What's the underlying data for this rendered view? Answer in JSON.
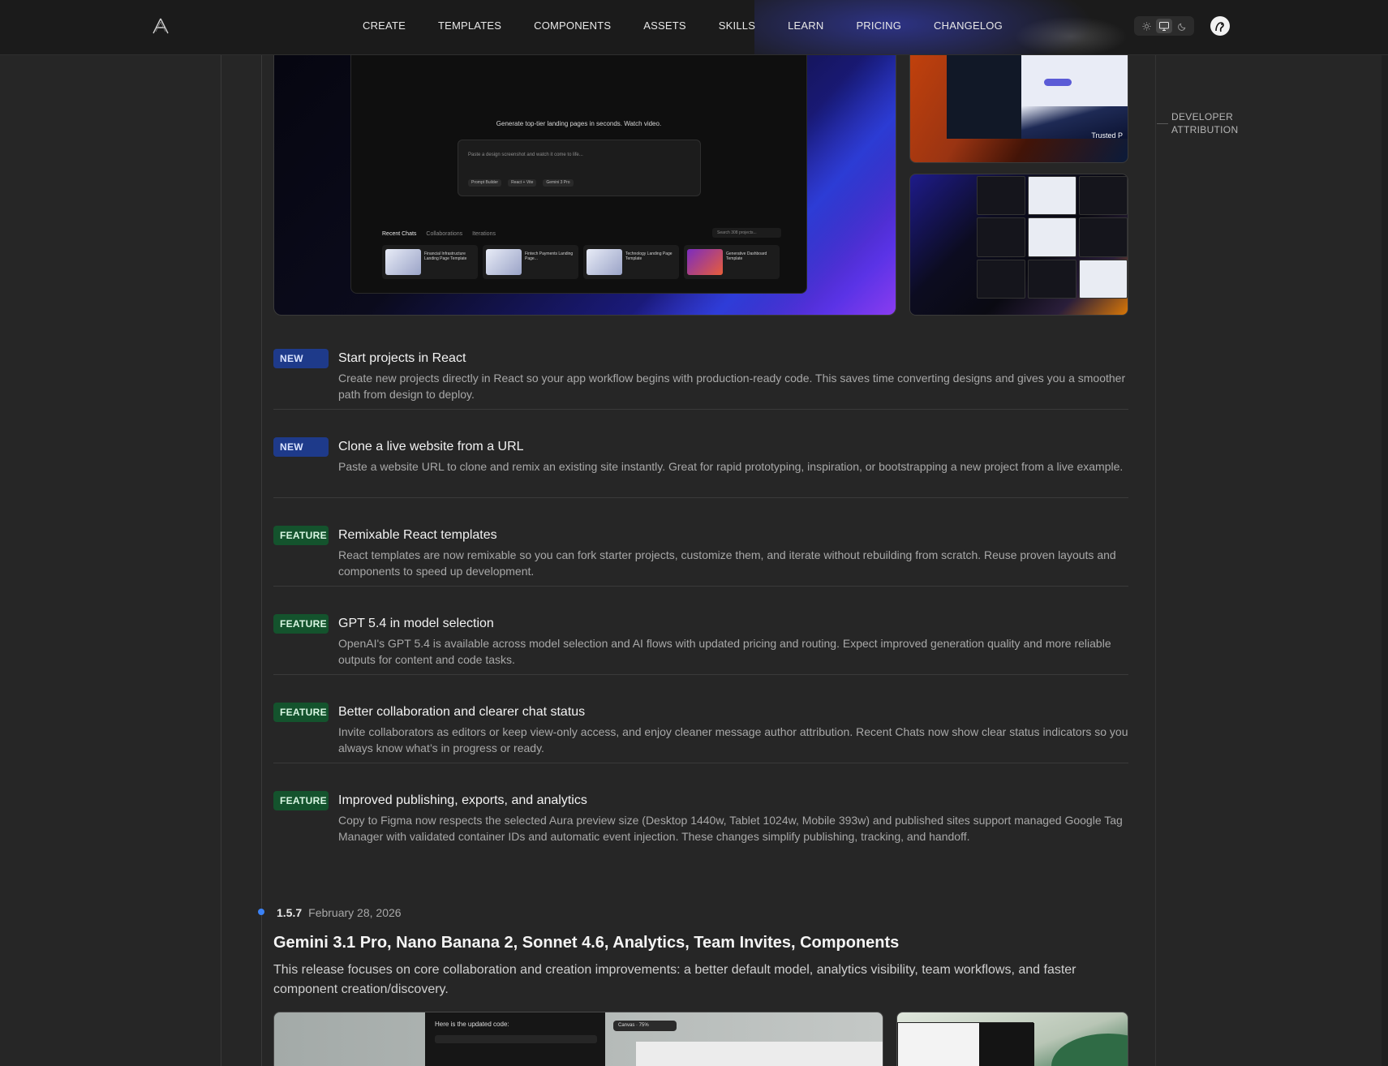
{
  "nav": {
    "items": [
      "CREATE",
      "TEMPLATES",
      "COMPONENTS",
      "ASSETS",
      "SKILLS",
      "LEARN",
      "PRICING",
      "CHANGELOG"
    ]
  },
  "toc": {
    "label": "DEVELOPER ATTRIBUTION"
  },
  "hero": {
    "subtitle": "Generate top-tier landing pages in seconds.  Watch video.",
    "prompt_placeholder": "Paste a design screenshot and watch it come to life...",
    "prompt_chips": [
      "Prompt Builder",
      "React + Vite",
      "Gemini 3 Pro"
    ],
    "tabs": [
      "Recent Chats",
      "Collaborations",
      "Iterations"
    ],
    "search_placeholder": "Search 308 projects...",
    "cards": [
      "Financial Infrastructure Landing Page Template",
      "Fintech Payments Landing Page...",
      "Technology Landing Page Template",
      "Generative Dashboard Template"
    ],
    "side_caption": "Trusted P"
  },
  "items": [
    {
      "badge": "NEW",
      "kind": "new",
      "title": "Start projects in React",
      "desc": "Create new projects directly in React so your app workflow begins with production-ready code. This saves time converting designs and gives you a smoother path from design to deploy."
    },
    {
      "badge": "NEW",
      "kind": "new",
      "title": "Clone a live website from a URL",
      "desc": "Paste a website URL to clone and remix an existing site instantly. Great for rapid prototyping, inspiration, or bootstrapping a new project from a live example."
    },
    {
      "badge": "FEATURE",
      "kind": "feature",
      "title": "Remixable React templates",
      "desc": "React templates are now remixable so you can fork starter projects, customize them, and iterate without rebuilding from scratch. Reuse proven layouts and components to speed up development."
    },
    {
      "badge": "FEATURE",
      "kind": "feature",
      "title": "GPT 5.4 in model selection",
      "desc": "OpenAI's GPT 5.4 is available across model selection and AI flows with updated pricing and routing. Expect improved generation quality and more reliable outputs for content and code tasks."
    },
    {
      "badge": "FEATURE",
      "kind": "feature",
      "title": "Better collaboration and clearer chat status",
      "desc": "Invite collaborators as editors or keep view-only access, and enjoy cleaner message author attribution. Recent Chats now show clear status indicators so you always know what’s in progress or ready."
    },
    {
      "badge": "FEATURE",
      "kind": "feature",
      "title": "Improved publishing, exports, and analytics",
      "desc": "Copy to Figma now respects the selected Aura preview size (Desktop 1440w, Tablet 1024w, Mobile 393w) and published sites support managed Google Tag Manager with validated container IDs and automatic event injection. These changes simplify publishing, tracking, and handoff."
    }
  ],
  "release": {
    "version": "1.5.7",
    "date": "February 28, 2026",
    "title": "Gemini 3.1 Pro, Nano Banana 2, Sonnet 4.6, Analytics, Team Invites, Components",
    "desc": "This release focuses on core collaboration and creation improvements: a better default model, analytics visibility, team workflows, and faster component creation/discovery.",
    "media_code_text": "Here is the updated code:",
    "media_canvas_chip": "Canvas  ·  75%"
  },
  "colors": {
    "background": "#262626",
    "new_badge": "#1e3a8a",
    "feature_badge": "#14532d",
    "timeline_dot": "#3b82f6"
  },
  "icons": {
    "logo": "aura-logo-icon",
    "theme": [
      "sun-icon",
      "monitor-icon",
      "moon-icon"
    ],
    "avatar": "user-avatar-icon"
  }
}
